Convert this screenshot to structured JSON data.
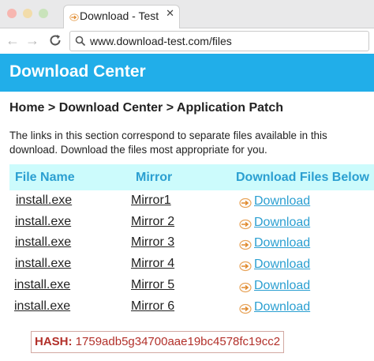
{
  "browser": {
    "tab_title": "Download - Test",
    "tab_close": "✕",
    "back_icon": "←",
    "forward_icon": "→",
    "url": "www.download-test.com/files"
  },
  "page": {
    "header_title": "Download Center",
    "breadcrumb": "Home > Download Center > Application Patch",
    "intro": "The links in this section correspond to separate files available in this download. Download the files most appropriate for you."
  },
  "table": {
    "headers": {
      "file": "File Name",
      "mirror": "Mirror",
      "download": "Download Files Below"
    },
    "rows": [
      {
        "file": "install.exe",
        "mirror": "Mirror1",
        "download": "Download"
      },
      {
        "file": "install.exe",
        "mirror": "Mirror 2",
        "download": "Download"
      },
      {
        "file": "install.exe",
        "mirror": "Mirror 3",
        "download": "Download"
      },
      {
        "file": "install.exe",
        "mirror": "Mirror 4",
        "download": "Download"
      },
      {
        "file": "install.exe",
        "mirror": "Mirror 5",
        "download": "Download"
      },
      {
        "file": "install.exe",
        "mirror": "Mirror 6",
        "download": "Download"
      }
    ]
  },
  "hash": {
    "label": "HASH:",
    "value": "1759adb5g34700aae19bc4578fc19cc2"
  },
  "colors": {
    "header_bg": "#21aee9",
    "table_header_bg": "#ccfbfc",
    "link": "#2b9fd1",
    "hash_text": "#b2302a"
  }
}
